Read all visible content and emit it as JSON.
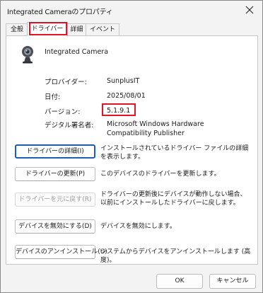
{
  "window": {
    "title": "Integrated Cameraのプロパティ"
  },
  "tabs": [
    {
      "label": "全般"
    },
    {
      "label": "ドライバー"
    },
    {
      "label": "詳細"
    },
    {
      "label": "イベント"
    }
  ],
  "device": {
    "name": "Integrated Camera",
    "icon": "webcam-icon"
  },
  "properties": [
    {
      "label": "プロバイダー:",
      "value": "SunplusIT"
    },
    {
      "label": "日付:",
      "value": "2025/08/01"
    },
    {
      "label": "バージョン:",
      "value": "5.1.9.1"
    },
    {
      "label": "デジタル署名者:",
      "value": "Microsoft Windows Hardware Compatibility Publisher"
    }
  ],
  "actions": [
    {
      "button": "ドライバーの詳細(I)",
      "description": "インストールされているドライバー ファイルの詳細を表示します。"
    },
    {
      "button": "ドライバーの更新(P)",
      "description": "このデバイスのドライバーを更新します。"
    },
    {
      "button": "ドライバーを元に戻す(R)",
      "description": "ドライバーの更新後にデバイスが動作しない場合、以前にインストールしたドライバーに戻します。"
    },
    {
      "button": "デバイスを無効にする(D)",
      "description": "デバイスを無効にします。"
    },
    {
      "button": "デバイスのアンインストール(U)",
      "description": "システムからデバイスをアンインストールします (高度)。"
    }
  ],
  "footer": {
    "ok": "OK",
    "cancel": "キャンセル"
  },
  "colors": {
    "highlight": "#e0132b",
    "focus": "#1b5fb4"
  }
}
